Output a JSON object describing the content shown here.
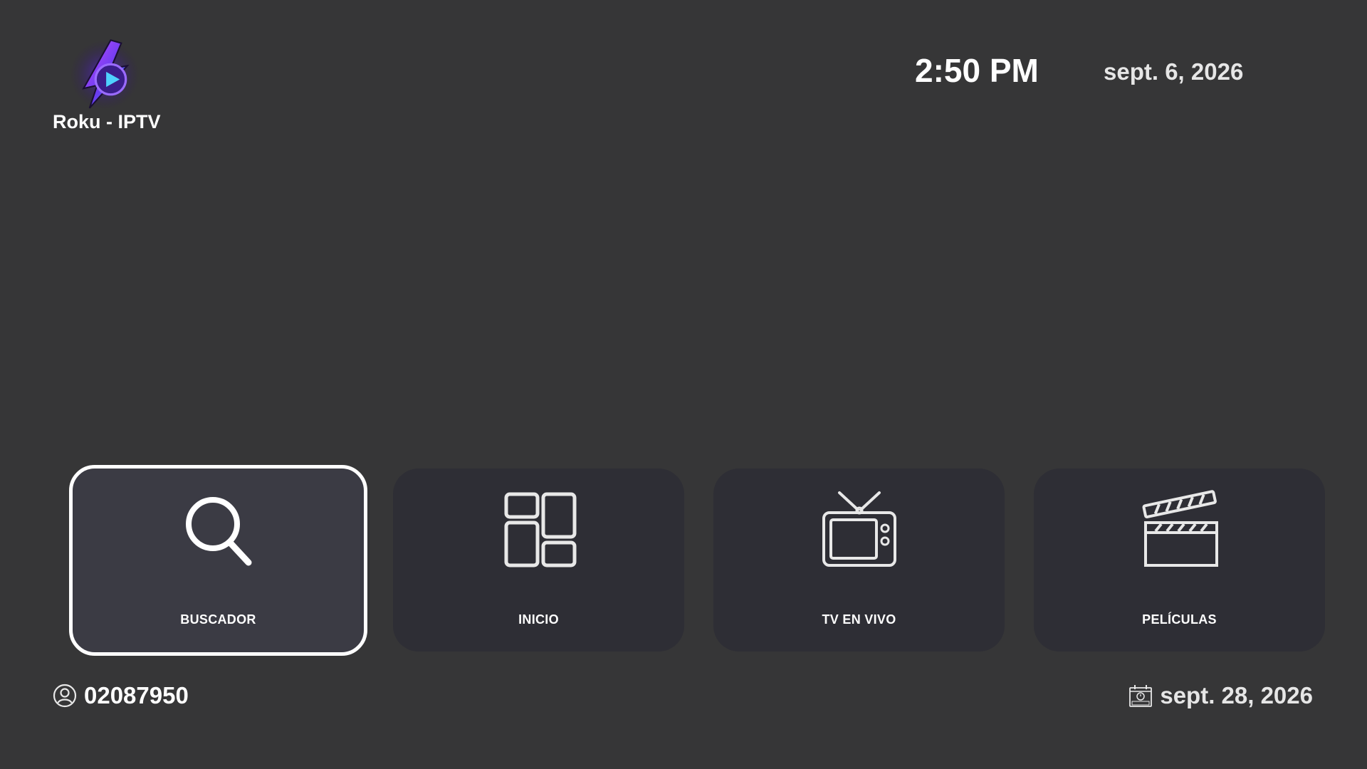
{
  "app": {
    "name": "Roku - IPTV",
    "logo_icon": "lightning-play-logo"
  },
  "header": {
    "time": "2:50 PM",
    "date": "sept. 6, 2026"
  },
  "menu": {
    "selected_index": 0,
    "items": [
      {
        "label": "BUSCADOR",
        "icon": "search-icon"
      },
      {
        "label": "INICIO",
        "icon": "dashboard-grid-icon"
      },
      {
        "label": "TV EN VIVO",
        "icon": "tv-icon"
      },
      {
        "label": "PELÍCULAS",
        "icon": "clapperboard-icon"
      }
    ]
  },
  "footer": {
    "account_id": "02087950",
    "account_icon": "user-circle-icon",
    "expiry_date": "sept. 28, 2026",
    "expiry_icon": "expired-calendar-icon"
  },
  "colors": {
    "background": "#363637",
    "tile": "#2e2e35",
    "tile_focused": "#3b3b44",
    "focus_border": "#ffffff",
    "logo_purple": "#8b3df0",
    "logo_blue": "#3fa0ff"
  }
}
